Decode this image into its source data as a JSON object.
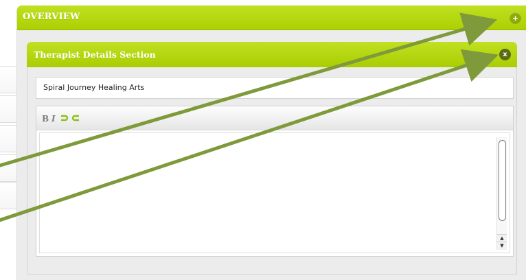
{
  "overview": {
    "title": "OVERVIEW",
    "add_icon": "plus-circle-icon",
    "add_label": "+"
  },
  "therapist_section": {
    "title": "Therapist Details Section",
    "close_icon": "close-circle-icon",
    "close_label": "x",
    "name_field_value": "Spiral Journey Healing Arts",
    "editor": {
      "bold_label": "B",
      "italic_label": "I",
      "link_icon": "link-icon",
      "unlink_icon": "unlink-icon",
      "content": ""
    },
    "scroll_up_label": "▲",
    "scroll_down_label": "▼"
  },
  "colors": {
    "accent_green": "#acd003",
    "annotation_arrow": "#7f9a3a",
    "close_button": "#5b6b13"
  }
}
